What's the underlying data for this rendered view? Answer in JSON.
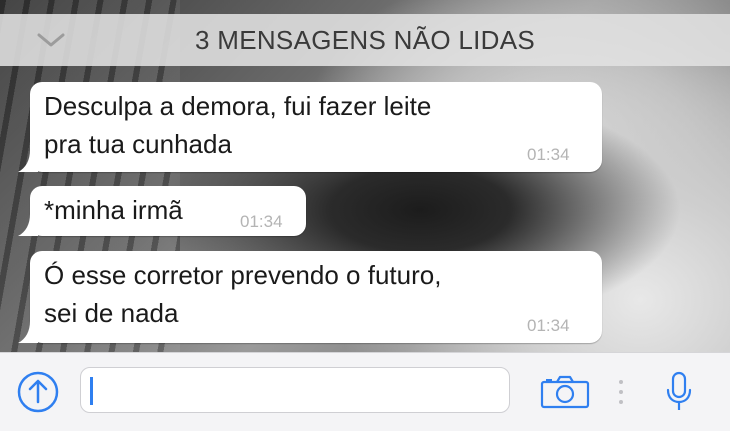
{
  "banner": {
    "label": "3 MENSAGENS NÃO LIDAS"
  },
  "messages": [
    {
      "text": "Desculpa a demora, fui fazer leite\npra tua cunhada",
      "time": "01:34"
    },
    {
      "text": "*minha irmã",
      "time": "01:34"
    },
    {
      "text": "Ó esse corretor prevendo o futuro,\nsei de nada",
      "time": "01:34"
    }
  ],
  "composer": {
    "value": "",
    "placeholder": ""
  },
  "icons": {
    "banner": "chevron-down-icon",
    "send": "arrow-up-circle-icon",
    "camera": "camera-icon",
    "mic": "microphone-icon",
    "separator": "vertical-dots-icon"
  },
  "colors": {
    "accent": "#2f7ff0",
    "bubble": "#ffffff",
    "timestamp": "#b4b4b4"
  }
}
